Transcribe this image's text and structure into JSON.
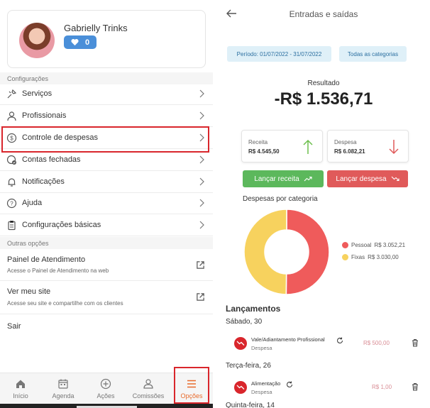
{
  "profile": {
    "name": "Gabrielly Trinks",
    "points": "0"
  },
  "config_section": {
    "label": "Configurações",
    "items": [
      {
        "label": "Serviços",
        "icon": "tools-icon"
      },
      {
        "label": "Profissionais",
        "icon": "person-icon"
      },
      {
        "label": "Controle de despesas",
        "icon": "dollar-circle-icon",
        "highlighted": true
      },
      {
        "label": "Contas fechadas",
        "icon": "closed-accounts-icon"
      },
      {
        "label": "Notificações",
        "icon": "bell-icon"
      },
      {
        "label": "Ajuda",
        "icon": "help-icon"
      },
      {
        "label": "Configurações básicas",
        "icon": "clipboard-icon"
      }
    ]
  },
  "other_section": {
    "label": "Outras opções",
    "items": [
      {
        "title": "Painel de Atendimento",
        "subtitle": "Acesse o Painel de Atendimento na web"
      },
      {
        "title": "Ver meu site",
        "subtitle": "Acesse seu site e compartilhe com os clientes"
      },
      {
        "title": "Sair",
        "subtitle": ""
      }
    ]
  },
  "bottom_nav": [
    {
      "label": "Início",
      "icon": "home-icon"
    },
    {
      "label": "Agenda",
      "icon": "calendar-icon"
    },
    {
      "label": "Ações",
      "icon": "plus-circle-icon"
    },
    {
      "label": "Comissões",
      "icon": "commission-icon"
    },
    {
      "label": "Opções",
      "icon": "menu-icon",
      "active": true
    }
  ],
  "expenses": {
    "title": "Entradas e saídas",
    "period_filter": "Período: 01/07/2022 - 31/07/2022",
    "category_filter": "Todas as categorias",
    "result_label": "Resultado",
    "result_value": "-R$ 1.536,71",
    "income": {
      "label": "Receita",
      "value": "R$ 4.545,50"
    },
    "expense": {
      "label": "Despesa",
      "value": "R$ 6.082,21"
    },
    "add_income_label": "Lançar receita",
    "add_expense_label": "Lançar despesa",
    "lancamentos_title": "Lançamentos",
    "days": [
      {
        "label": "Sábado, 30",
        "entries": [
          {
            "title": "Vale/Adiantamento Profissional",
            "type": "Despesa",
            "value": "R$ 500,00"
          }
        ]
      },
      {
        "label": "Terça-feira, 26",
        "entries": [
          {
            "title": "Alimentação",
            "type": "Despesa",
            "value": "R$ 1,00"
          }
        ]
      }
    ],
    "next_day_partial": "Quinta-feira, 14"
  },
  "colors": {
    "accent_orange": "#e86b2c",
    "highlight_red": "#d9262c",
    "income_green": "#5cb85c",
    "expense_red": "#e05a5a",
    "pessoal": "#ef5b5b",
    "fixas": "#f7d25e",
    "badge_blue": "#4a8fd9"
  },
  "chart_data": {
    "type": "pie",
    "title": "Despesas por categoria",
    "categories": [
      "Pessoal",
      "Fixas"
    ],
    "values": [
      3052.21,
      3030.0
    ],
    "value_labels": [
      "R$ 3.052,21",
      "R$ 3.030,00"
    ],
    "colors": [
      "#ef5b5b",
      "#f7d25e"
    ],
    "donut": true,
    "legend_position": "right"
  }
}
